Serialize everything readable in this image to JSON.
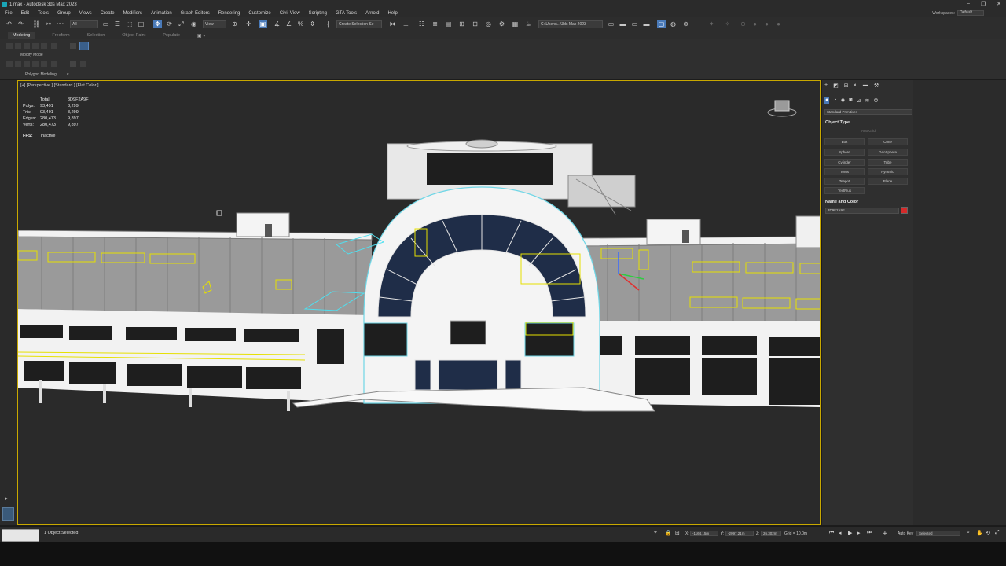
{
  "window": {
    "title": "1.max - Autodesk 3ds Max 2023"
  },
  "menu": {
    "items": [
      "File",
      "Edit",
      "Tools",
      "Group",
      "Views",
      "Create",
      "Modifiers",
      "Animation",
      "Graph Editors",
      "Rendering",
      "Customize",
      "Civil View",
      "Scripting",
      "GTA Tools",
      "Arnold",
      "Help"
    ],
    "workspace_label": "Workspaces:",
    "workspace_value": "Default"
  },
  "toolbar": {
    "filter_value": "All",
    "view_value": "View",
    "selection_set_placeholder": "Create Selection Se",
    "path_value": "C:\\Users\\...\\3ds Max 2023"
  },
  "ribbon": {
    "tabs": [
      "Modeling",
      "Freeform",
      "Selection",
      "Object Paint",
      "Populate"
    ],
    "active_tab": "Modeling",
    "modify_mode": "Modify Mode",
    "polygon_modeling": "Polygon Modeling"
  },
  "viewport": {
    "label": "[+] [Perspective ] [Standard ] [Flat Color ]",
    "stats": {
      "header_total": "Total",
      "header_object": "3D9F2A9F",
      "rows": [
        {
          "label": "Polys:",
          "total": "93,491",
          "object": "3,299"
        },
        {
          "label": "Tris:",
          "total": "93,491",
          "object": "3,299"
        },
        {
          "label": "Edges:",
          "total": "280,473",
          "object": "9,897"
        },
        {
          "label": "Verts:",
          "total": "280,473",
          "object": "9,897"
        }
      ]
    },
    "fps_label": "FPS:",
    "fps_value": "Inactive"
  },
  "command_panel": {
    "category": "Standard Primitives",
    "object_type_title": "Object Type",
    "autogrid": "AutoGrid",
    "primitives": [
      "Box",
      "Cone",
      "Sphere",
      "GeoSphere",
      "Cylinder",
      "Tube",
      "Torus",
      "Pyramid",
      "Teapot",
      "Plane",
      "TextPlus"
    ],
    "name_color_title": "Name and Color",
    "object_name": "3D9F2A9F",
    "object_color": "#d42a2a"
  },
  "statusbar": {
    "selection": "1 Object Selected",
    "x_label": "X:",
    "x_value": "-1164.15m",
    "y_label": "Y:",
    "y_value": "-2097.21m",
    "z_label": "Z:",
    "z_value": "26.302m",
    "grid": "Grid = 10.0m",
    "auto_key": "Auto Key",
    "set_key_mode": "Selected"
  }
}
